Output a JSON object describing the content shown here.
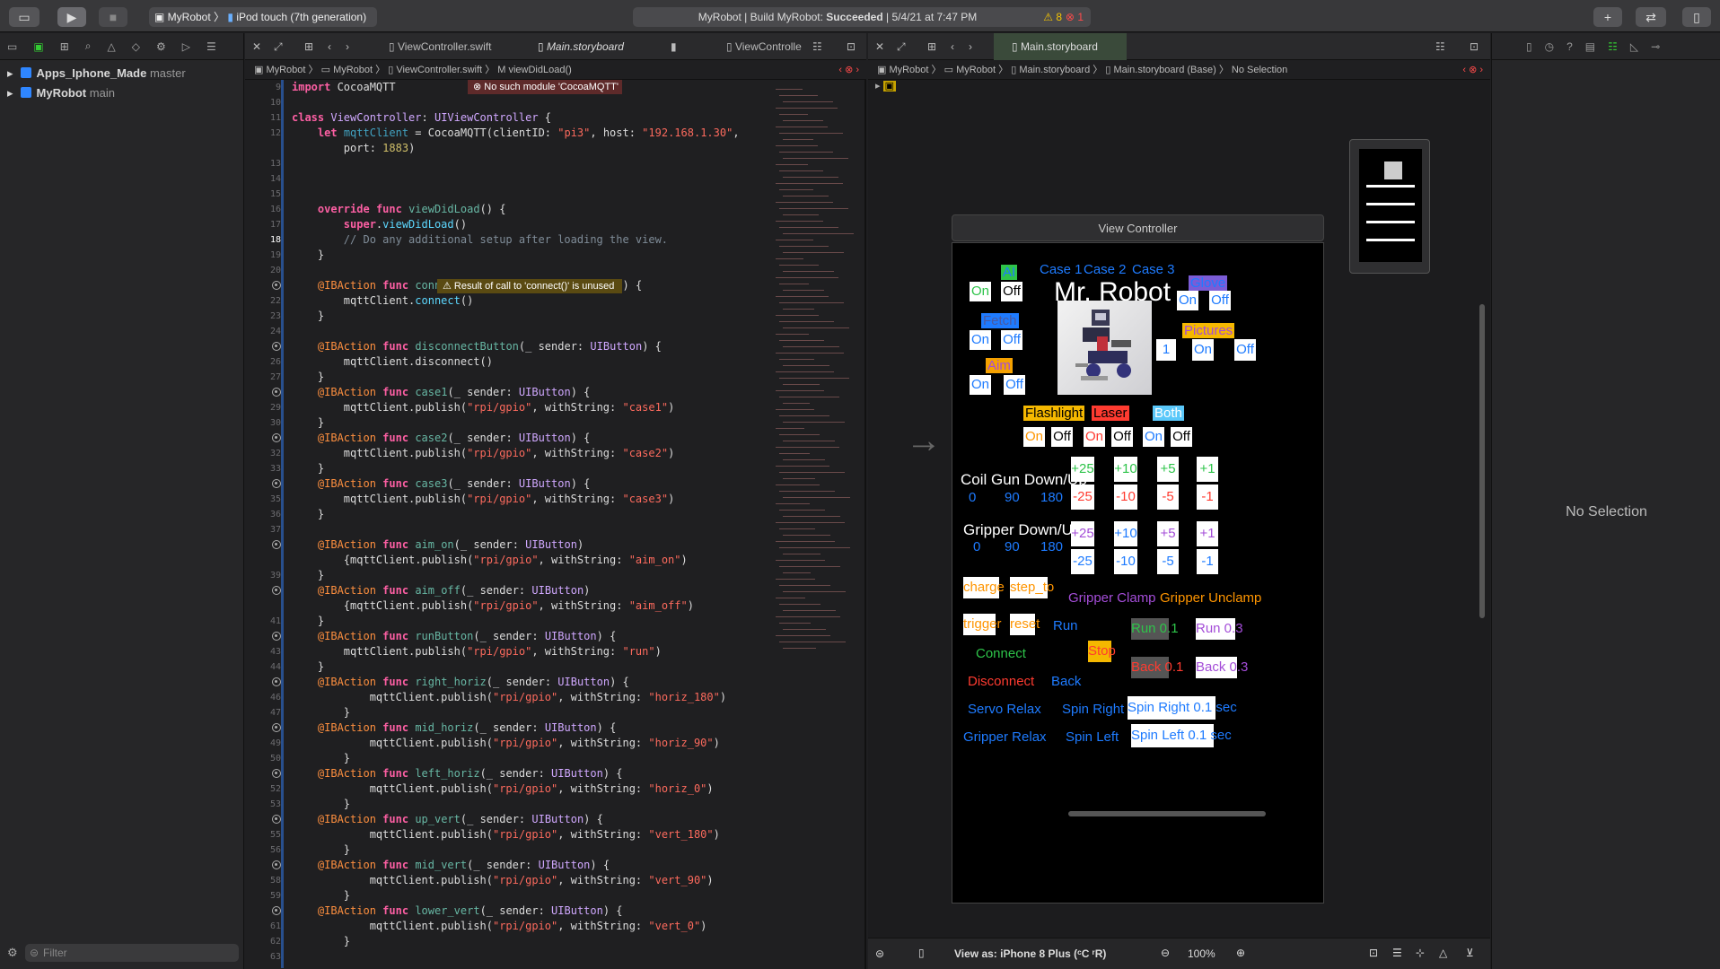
{
  "toolbar": {
    "scheme_project": "MyRobot",
    "scheme_device": "iPod touch (7th generation)",
    "activity_prefix": "MyRobot | Build MyRobot:",
    "activity_status": "Succeeded",
    "activity_time": "| 5/4/21 at 7:47 PM",
    "warning_count": "8",
    "error_count": "1"
  },
  "navigator": {
    "items": [
      {
        "name": "Apps_Iphone_Made",
        "branch": "master"
      },
      {
        "name": "MyRobot",
        "branch": "main"
      }
    ],
    "filter_placeholder": "Filter"
  },
  "left_editor": {
    "tabs": [
      "ViewController.swift",
      "Main.storyboard",
      "ViewControlle"
    ],
    "jump_bar": [
      "MyRobot",
      "MyRobot",
      "ViewController.swift",
      "viewDidLoad()"
    ],
    "error_message": "No such module 'CocoaMQTT'",
    "warning_message": "Result of call to 'connect()' is unused",
    "code_lines": [
      {
        "n": "9",
        "html": "<span class='kw'>import</span> CocoaMQTT"
      },
      {
        "n": "10",
        "html": ""
      },
      {
        "n": "11",
        "html": "<span class='kw'>class</span> <span class='ty'>ViewController</span>: <span class='ty'>UIViewController</span> {"
      },
      {
        "n": "12",
        "html": "    <span class='kw'>let</span> <span class='bl'>mqttClient</span> = CocoaMQTT(clientID: <span class='st'>\"pi3\"</span>, host: <span class='st'>\"192.168.1.30\"</span>,"
      },
      {
        "n": "",
        "html": "        port: <span class='nm'>1883</span>)"
      },
      {
        "n": "13",
        "html": ""
      },
      {
        "n": "14",
        "html": ""
      },
      {
        "n": "15",
        "html": ""
      },
      {
        "n": "16",
        "html": "    <span class='kw'>override</span> <span class='kw'>func</span> <span class='fn'>viewDidLoad</span>() {"
      },
      {
        "n": "17",
        "html": "        <span class='kw'>super</span>.<span class='pr'>viewDidLoad</span>()"
      },
      {
        "n": "18",
        "html": "        <span class='cm'>// Do any additional setup after loading the view.</span>"
      },
      {
        "n": "19",
        "html": "    }"
      },
      {
        "n": "20",
        "html": ""
      },
      {
        "n": "bp",
        "html": "    <span class='at'>@IBAction</span> <span class='kw'>func</span> <span class='fn'>connectButton</span>(_ sender: <span class='ty'>UIButton</span>) {"
      },
      {
        "n": "22",
        "html": "        mqttClient.<span class='pr'>connect</span>()"
      },
      {
        "n": "23",
        "html": "    }"
      },
      {
        "n": "24",
        "html": ""
      },
      {
        "n": "bp",
        "html": "    <span class='at'>@IBAction</span> <span class='kw'>func</span> <span class='fn'>disconnectButton</span>(_ sender: <span class='ty'>UIButton</span>) {"
      },
      {
        "n": "26",
        "html": "        mqttClient.disconnect()"
      },
      {
        "n": "27",
        "html": "    }"
      },
      {
        "n": "bp",
        "html": "    <span class='at'>@IBAction</span> <span class='kw'>func</span> <span class='fn'>case1</span>(_ sender: <span class='ty'>UIButton</span>) {"
      },
      {
        "n": "29",
        "html": "        mqttClient.publish(<span class='st'>\"rpi/gpio\"</span>, withString: <span class='st'>\"case1\"</span>)"
      },
      {
        "n": "30",
        "html": "    }"
      },
      {
        "n": "bp",
        "html": "    <span class='at'>@IBAction</span> <span class='kw'>func</span> <span class='fn'>case2</span>(_ sender: <span class='ty'>UIButton</span>) {"
      },
      {
        "n": "32",
        "html": "        mqttClient.publish(<span class='st'>\"rpi/gpio\"</span>, withString: <span class='st'>\"case2\"</span>)"
      },
      {
        "n": "33",
        "html": "    }"
      },
      {
        "n": "bp",
        "html": "    <span class='at'>@IBAction</span> <span class='kw'>func</span> <span class='fn'>case3</span>(_ sender: <span class='ty'>UIButton</span>) {"
      },
      {
        "n": "35",
        "html": "        mqttClient.publish(<span class='st'>\"rpi/gpio\"</span>, withString: <span class='st'>\"case3\"</span>)"
      },
      {
        "n": "36",
        "html": "    }"
      },
      {
        "n": "37",
        "html": ""
      },
      {
        "n": "bp",
        "html": "    <span class='at'>@IBAction</span> <span class='kw'>func</span> <span class='fn'>aim_on</span>(_ sender: <span class='ty'>UIButton</span>)"
      },
      {
        "n": "",
        "html": "        {mqttClient.publish(<span class='st'>\"rpi/gpio\"</span>, withString: <span class='st'>\"aim_on\"</span>)"
      },
      {
        "n": "39",
        "html": "    }"
      },
      {
        "n": "bp",
        "html": "    <span class='at'>@IBAction</span> <span class='kw'>func</span> <span class='fn'>aim_off</span>(_ sender: <span class='ty'>UIButton</span>)"
      },
      {
        "n": "",
        "html": "        {mqttClient.publish(<span class='st'>\"rpi/gpio\"</span>, withString: <span class='st'>\"aim_off\"</span>)"
      },
      {
        "n": "41",
        "html": "    }"
      },
      {
        "n": "bp",
        "html": "    <span class='at'>@IBAction</span> <span class='kw'>func</span> <span class='fn'>runButton</span>(_ sender: <span class='ty'>UIButton</span>) {"
      },
      {
        "n": "43",
        "html": "        mqttClient.publish(<span class='st'>\"rpi/gpio\"</span>, withString: <span class='st'>\"run\"</span>)"
      },
      {
        "n": "44",
        "html": "    }"
      },
      {
        "n": "bp",
        "html": "    <span class='at'>@IBAction</span> <span class='kw'>func</span> <span class='fn'>right_horiz</span>(_ sender: <span class='ty'>UIButton</span>) {"
      },
      {
        "n": "46",
        "html": "            mqttClient.publish(<span class='st'>\"rpi/gpio\"</span>, withString: <span class='st'>\"horiz_180\"</span>)"
      },
      {
        "n": "47",
        "html": "        }"
      },
      {
        "n": "bp",
        "html": "    <span class='at'>@IBAction</span> <span class='kw'>func</span> <span class='fn'>mid_horiz</span>(_ sender: <span class='ty'>UIButton</span>) {"
      },
      {
        "n": "49",
        "html": "            mqttClient.publish(<span class='st'>\"rpi/gpio\"</span>, withString: <span class='st'>\"horiz_90\"</span>)"
      },
      {
        "n": "50",
        "html": "        }"
      },
      {
        "n": "bp",
        "html": "    <span class='at'>@IBAction</span> <span class='kw'>func</span> <span class='fn'>left_horiz</span>(_ sender: <span class='ty'>UIButton</span>) {"
      },
      {
        "n": "52",
        "html": "            mqttClient.publish(<span class='st'>\"rpi/gpio\"</span>, withString: <span class='st'>\"horiz_0\"</span>)"
      },
      {
        "n": "53",
        "html": "        }"
      },
      {
        "n": "bp",
        "html": "    <span class='at'>@IBAction</span> <span class='kw'>func</span> <span class='fn'>up_vert</span>(_ sender: <span class='ty'>UIButton</span>) {"
      },
      {
        "n": "55",
        "html": "            mqttClient.publish(<span class='st'>\"rpi/gpio\"</span>, withString: <span class='st'>\"vert_180\"</span>)"
      },
      {
        "n": "56",
        "html": "        }"
      },
      {
        "n": "bp",
        "html": "    <span class='at'>@IBAction</span> <span class='kw'>func</span> <span class='fn'>mid_vert</span>(_ sender: <span class='ty'>UIButton</span>) {"
      },
      {
        "n": "58",
        "html": "            mqttClient.publish(<span class='st'>\"rpi/gpio\"</span>, withString: <span class='st'>\"vert_90\"</span>)"
      },
      {
        "n": "59",
        "html": "        }"
      },
      {
        "n": "bp",
        "html": "    <span class='at'>@IBAction</span> <span class='kw'>func</span> <span class='fn'>lower_vert</span>(_ sender: <span class='ty'>UIButton</span>) {"
      },
      {
        "n": "61",
        "html": "            mqttClient.publish(<span class='st'>\"rpi/gpio\"</span>, withString: <span class='st'>\"vert_0\"</span>)"
      },
      {
        "n": "62",
        "html": "        }"
      },
      {
        "n": "63",
        "html": ""
      }
    ]
  },
  "right_editor": {
    "tab": "Main.storyboard",
    "jump_bar": [
      "MyRobot",
      "MyRobot",
      "Main.storyboard",
      "Main.storyboard (Base)",
      "No Selection"
    ],
    "scene_title": "View Controller",
    "view_as": "View as: iPhone 8 Plus (ᶜC ʳR)",
    "zoom": "100%"
  },
  "robot_ui": {
    "title": "Mr. Robot",
    "ai": "AI",
    "on": "On",
    "off": "Off",
    "case1": "Case 1",
    "case2": "Case 2",
    "case3": "Case 3",
    "glove": "Glove",
    "fetch": "Fetch",
    "pictures": "Pictures",
    "one": "1",
    "aim": "Aim",
    "flashlight": "Flashlight",
    "laser": "Laser",
    "both": "Both",
    "coil_gun": "Coil Gun Down/Up",
    "gripper": "Gripper Down/Up",
    "deg0": "0",
    "deg90": "90",
    "deg180": "180",
    "p25": "+25",
    "p10": "+10",
    "p5": "+5",
    "p1": "+1",
    "m25": "-25",
    "m10": "-10",
    "m5": "-5",
    "m1": "-1",
    "charge": "charge",
    "step_to": "step_to",
    "gripper_clamp": "Gripper Clamp",
    "gripper_unclamp": "Gripper Unclamp",
    "trigger": "trigger",
    "reset": "reset",
    "run": "Run",
    "run01": "Run 0.1",
    "run03": "Run 0.3",
    "connect": "Connect",
    "stop": "Stop",
    "disconnect": "Disconnect",
    "back": "Back",
    "back01": "Back 0.1",
    "back03": "Back 0.3",
    "servo_relax": "Servo Relax",
    "spin_right": "Spin Right",
    "spin_right_01": "Spin Right 0.1 sec",
    "gripper_relax": "Gripper Relax",
    "spin_left": "Spin Left",
    "spin_left_01": "Spin Left 0.1 sec"
  },
  "inspector": {
    "empty_label": "No Selection"
  }
}
